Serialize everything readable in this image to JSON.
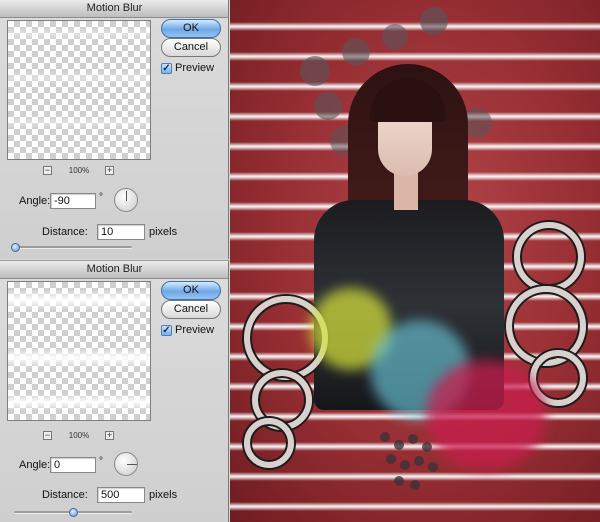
{
  "dialogs": [
    {
      "title": "Motion Blur",
      "zoom": "100%",
      "zoom_out": "−",
      "zoom_in": "+",
      "ok_label": "OK",
      "cancel_label": "Cancel",
      "preview_label": "Preview",
      "preview_checked": true,
      "angle_label": "Angle:",
      "angle_value": "-90",
      "degree_symbol": "°",
      "distance_label": "Distance:",
      "distance_value": "10",
      "distance_unit": "pixels",
      "distance_slider_fraction": 0.01
    },
    {
      "title": "Motion Blur",
      "zoom": "100%",
      "zoom_out": "−",
      "zoom_in": "+",
      "ok_label": "OK",
      "cancel_label": "Cancel",
      "preview_label": "Preview",
      "preview_checked": true,
      "angle_label": "Angle:",
      "angle_value": "0",
      "degree_symbol": "°",
      "distance_label": "Distance:",
      "distance_value": "500",
      "distance_unit": "pixels",
      "distance_slider_fraction": 0.5
    }
  ],
  "icons": {
    "checkmark": "check-icon",
    "angle_dial": "angle-dial-icon"
  },
  "colors": {
    "accent_button": "#6fa8e6",
    "canvas_red": "#962e33",
    "glow_yellow": "#d6e23a",
    "glow_cyan": "#6fd3e8",
    "glow_magenta": "#c81e4e"
  }
}
